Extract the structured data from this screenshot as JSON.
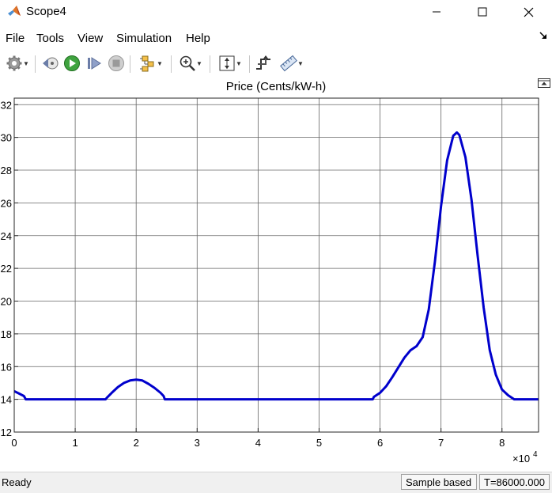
{
  "window": {
    "title": "Scope4"
  },
  "menu": {
    "items": [
      "File",
      "Tools",
      "View",
      "Simulation",
      "Help"
    ]
  },
  "toolbar": {
    "buttons": [
      "settings-icon",
      "step-back-icon",
      "run-icon",
      "step-forward-icon",
      "stop-icon",
      "signal-layout-icon",
      "zoom-icon",
      "autoscale-icon",
      "triggers-icon",
      "measurements-icon"
    ]
  },
  "plot": {
    "title": "Price (Cents/kW-h)",
    "x_exponent_label": "×10",
    "x_exponent_power": "4"
  },
  "chart_data": {
    "type": "line",
    "title": "Price (Cents/kW-h)",
    "xlabel": "",
    "ylabel": "",
    "xlim": [
      0,
      86000
    ],
    "ylim": [
      12,
      32.4
    ],
    "x_ticks": [
      0,
      1,
      2,
      3,
      4,
      5,
      6,
      7,
      8
    ],
    "y_ticks": [
      12,
      14,
      16,
      18,
      20,
      22,
      24,
      26,
      28,
      30,
      32
    ],
    "grid": true,
    "color": "#0000cc",
    "series": [
      {
        "x": [
          0,
          800,
          1600,
          1900,
          2200,
          15000,
          15200,
          16000,
          17000,
          18000,
          19000,
          20000,
          21000,
          22000,
          23000,
          24000,
          24500,
          24700,
          58800,
          59000,
          60000,
          61000,
          62000,
          63000,
          64000,
          65000,
          66000,
          67000,
          68000,
          69000,
          70000,
          71000,
          72000,
          72600,
          73000,
          74000,
          75000,
          76000,
          77000,
          78000,
          79000,
          80000,
          81000,
          82000,
          82500,
          86000
        ],
        "y": [
          14.5,
          14.35,
          14.2,
          14.0,
          14.0,
          14.0,
          14.1,
          14.4,
          14.75,
          15.0,
          15.15,
          15.2,
          15.15,
          14.95,
          14.7,
          14.4,
          14.2,
          14.0,
          14.0,
          14.15,
          14.4,
          14.8,
          15.35,
          15.95,
          16.55,
          17.0,
          17.25,
          17.8,
          19.5,
          22.4,
          25.8,
          28.6,
          30.1,
          30.3,
          30.15,
          28.8,
          26.2,
          22.8,
          19.6,
          17.0,
          15.5,
          14.6,
          14.25,
          14.0,
          14.0,
          14.0
        ]
      }
    ]
  },
  "status": {
    "ready": "Ready",
    "mode": "Sample based",
    "time": "T=86000.000"
  }
}
